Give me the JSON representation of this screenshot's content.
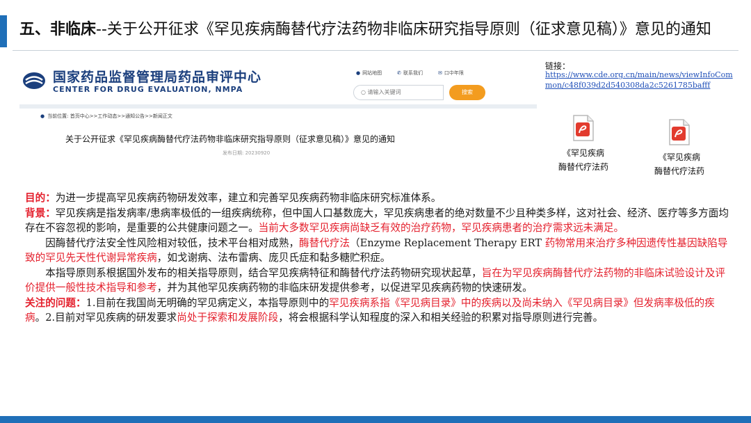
{
  "slide": {
    "title_prefix": "五、非临床",
    "title_rest": "--关于公开征求《罕见疾病酶替代疗法药物非临床研究指导原则（征求意见稿）》意见的通知"
  },
  "website": {
    "site_name_cn": "国家药品监督管理局药品审评中心",
    "site_name_en": "CENTER FOR DRUG EVALUATION, NMPA",
    "top_links": [
      "网站地图",
      "联系我们",
      "口中年限"
    ],
    "search_placeholder": "请输入关键词",
    "search_button": "搜索",
    "breadcrumb": "当前位置: 首页中心>>工作动态>>通知公告>>新闻正文",
    "notice_title": "关于公开征求《罕见疾病酶替代疗法药物非临床研究指导原则（征求意见稿）》意见的通知",
    "publish_date": "发布日期: 20230920"
  },
  "link": {
    "label": "链接：",
    "url": "https://www.cde.org.cn/main/news/viewInfoCommon/c48f039d2d540308da2c5261785bafff"
  },
  "attachments": [
    {
      "name_line1": "《罕见疾病",
      "name_line2": "酶替代疗法药",
      "icon": "pdf-file-icon"
    },
    {
      "name_line1": "《罕见疾病",
      "name_line2": "酶替代疗法药",
      "icon": "pdf-file-icon"
    }
  ],
  "body": {
    "purpose_label": "目的：",
    "purpose": "为进一步提高罕见疾病药物研发效率，建立和完善罕见疾病药物非临床研究标准体系。",
    "background_label": "背景：",
    "background": "罕见疾病是指发病率/患病率极低的一组疾病统称，但中国人口基数庞大，罕见疾病患者的绝对数量不少且种类多样，这对社会、经济、医疗等多方面均存在不容忽视的影响，是重要的公共健康问题之一。",
    "background_red": "当前大多数罕见疾病尚缺乏有效的治疗药物，罕见疾病患者的治疗需求远未满足。",
    "ert_1": "因酶替代疗法安全性风险相对较低，技术平台相对成熟，",
    "ert_red1": "酶替代疗法",
    "ert_2": "（Enzyme Replacement Therapy ERT",
    "ert_red2": "药物常用来治疗多种因遗传性基因缺陷导致的罕见先天性代谢异常疾病",
    "ert_3": "，如戈谢病、法布雷病、庞贝氏症和黏多糖贮积症。",
    "guide_1": "本指导原则系根据国外发布的相关指导原则，结合罕见疾病特征和酶替代疗法药物研究现状起草，",
    "guide_red": "旨在为罕见疾病酶替代疗法药物的非临床试验设计及评价提供一般性技术指导和参考",
    "guide_2": "，并为其他罕见疾病药物的非临床研发提供参考，以促进罕见疾病药物的快速研发。",
    "focus_label": "关注的问题：",
    "focus_1": "1.目前在我国尚无明确的罕见病定义，本指导原则中的",
    "focus_red1": "罕见疾病系指《罕见病目录》中的疾病以及尚未纳入《罕见病目录》但发病率极低的疾病",
    "focus_2": "。2.目前对罕见疾病的研发要求",
    "focus_red2": "尚处于探索和发展阶段",
    "focus_3": "，将会根据科学认知程度的深入和相关经验的积累对指导原则进行完善。"
  },
  "colors": {
    "accent": "#1f6fb8",
    "highlight_red": "#e4202d",
    "search_orange": "#f39c1f",
    "logo_navy": "#1b3f7d"
  }
}
